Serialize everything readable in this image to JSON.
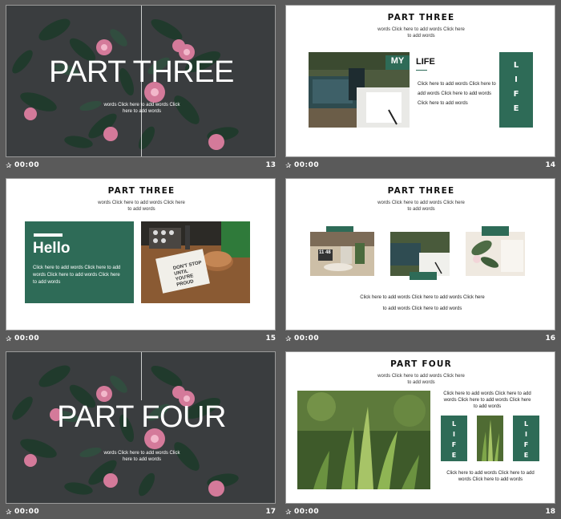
{
  "slides": [
    {
      "number": "13",
      "time": "00:00",
      "title": "PART THREE",
      "body": "words Click here to add words Click here to add words"
    },
    {
      "number": "14",
      "time": "00:00",
      "title": "PART THREE",
      "subtitle": "words Click here to add words Click here to add words",
      "label_my": "MY",
      "label_life": "LIFE",
      "body": "Click here to add words Click here to add words Click here to add words Click here to add words",
      "vertical": "LIFE"
    },
    {
      "number": "15",
      "time": "00:00",
      "title": "PART THREE",
      "subtitle": "words Click here to add words Click here to add words",
      "hello": "Hello",
      "body": "Click here to add words Click here to add words Click here to add words Click here to add words",
      "book_text": "DON'T STOP UNTIL YOU'RE PROUD"
    },
    {
      "number": "16",
      "time": "00:00",
      "title": "PART THREE",
      "subtitle": "words Click here to add words Click here to add words",
      "body": "Click here to add words Click here to add words Click here to add words Click here to add words",
      "clock_text": "11 48"
    },
    {
      "number": "17",
      "time": "00:00",
      "title": "PART FOUR",
      "body": "words Click here to add words Click here to add words"
    },
    {
      "number": "18",
      "time": "00:00",
      "title": "PART FOUR",
      "subtitle": "words Click here to add words Click here to add words",
      "body_top": "Click here to add words Click here to add words Click here to add words Click here to add words",
      "vertical_left": "LIFE",
      "vertical_right": "LIFE",
      "body_bottom": "Click here to add words Click here to add words Click here to add words"
    }
  ]
}
